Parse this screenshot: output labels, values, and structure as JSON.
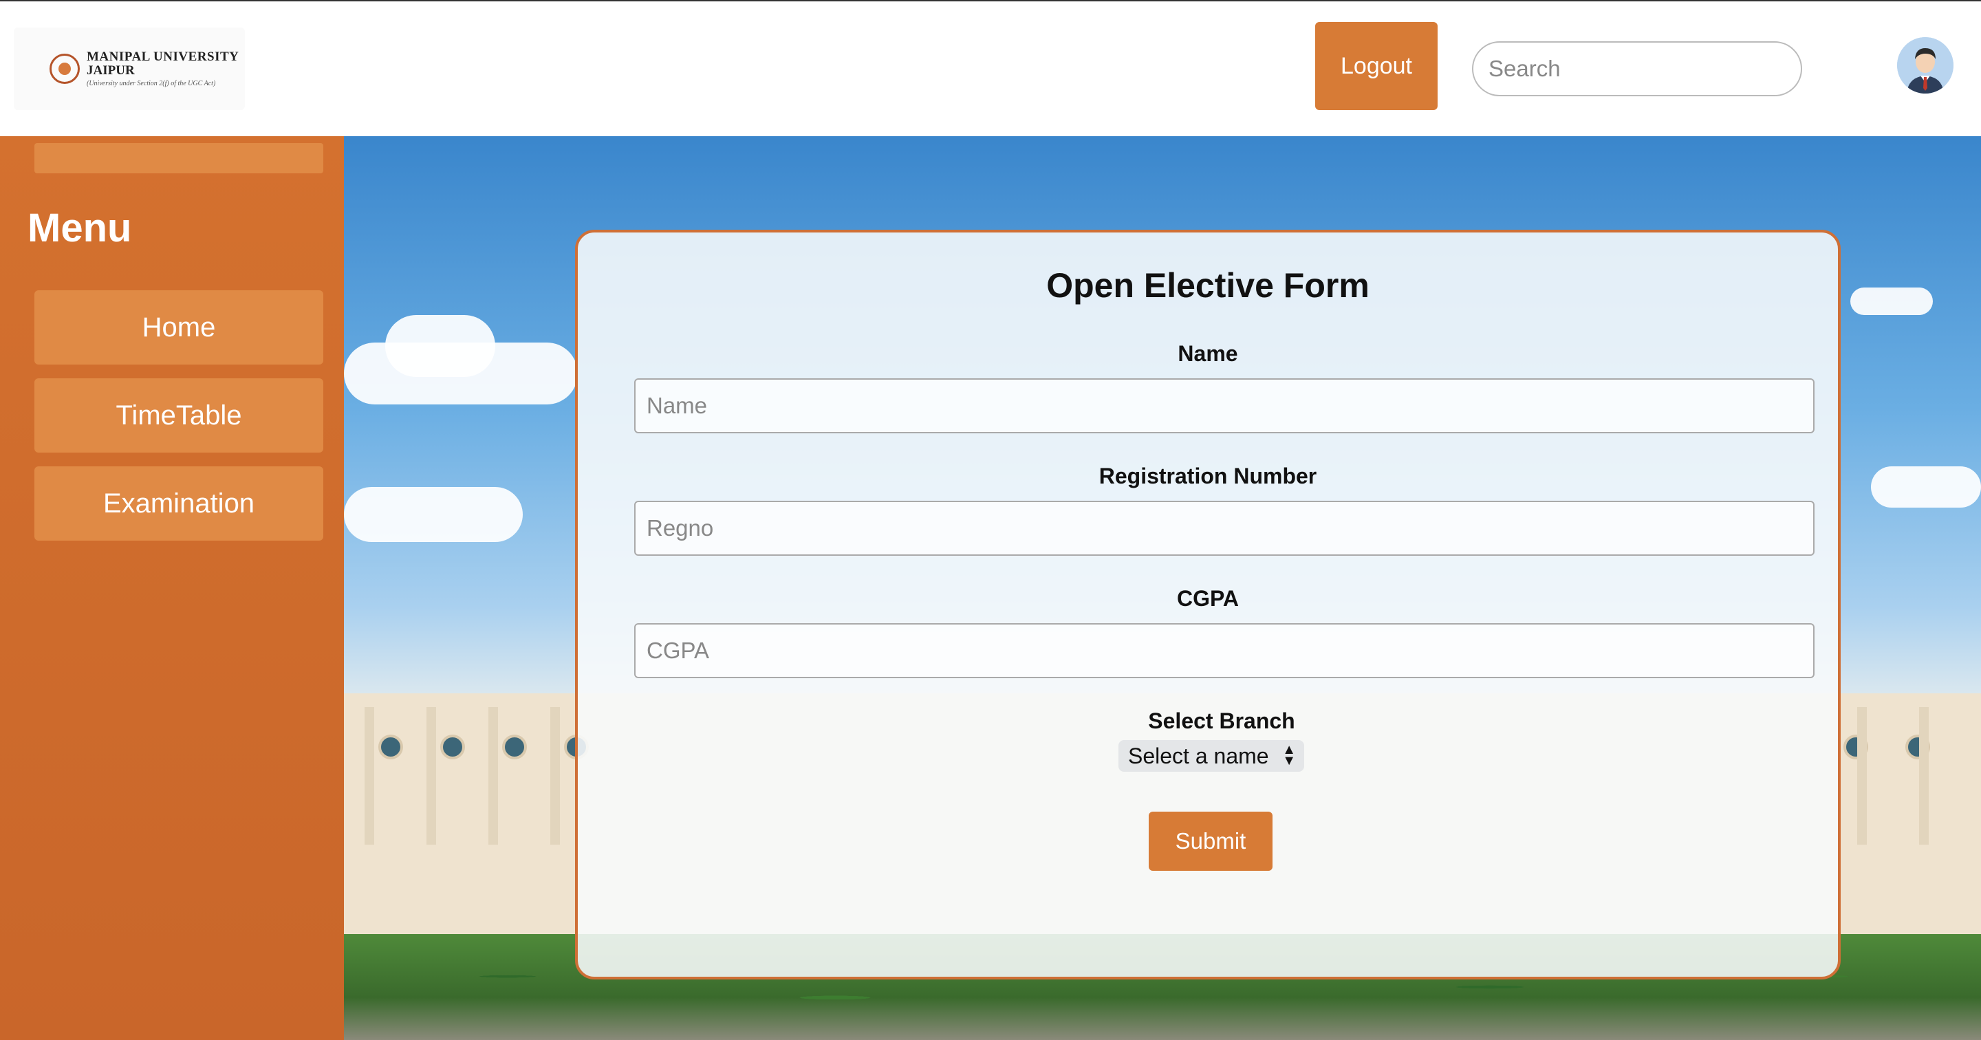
{
  "header": {
    "logo": {
      "line1": "MANIPAL UNIVERSITY",
      "line2": "JAIPUR",
      "line3": "(University under Section 2(f) of the UGC Act)"
    },
    "logout_label": "Logout",
    "search_placeholder": "Search"
  },
  "sidebar": {
    "title": "Menu",
    "items": [
      {
        "label": "Home"
      },
      {
        "label": "TimeTable"
      },
      {
        "label": "Examination"
      }
    ]
  },
  "form": {
    "title": "Open Elective Form",
    "name_label": "Name",
    "name_placeholder": "Name",
    "regno_label": "Registration Number",
    "regno_placeholder": "Regno",
    "cgpa_label": "CGPA",
    "cgpa_placeholder": "CGPA",
    "branch_label": "Select Branch",
    "branch_selected": "Select a name",
    "submit_label": "Submit"
  },
  "colors": {
    "accent": "#d77b36",
    "sidebar": "#cc6a2c",
    "card_border": "#cf6f36"
  }
}
